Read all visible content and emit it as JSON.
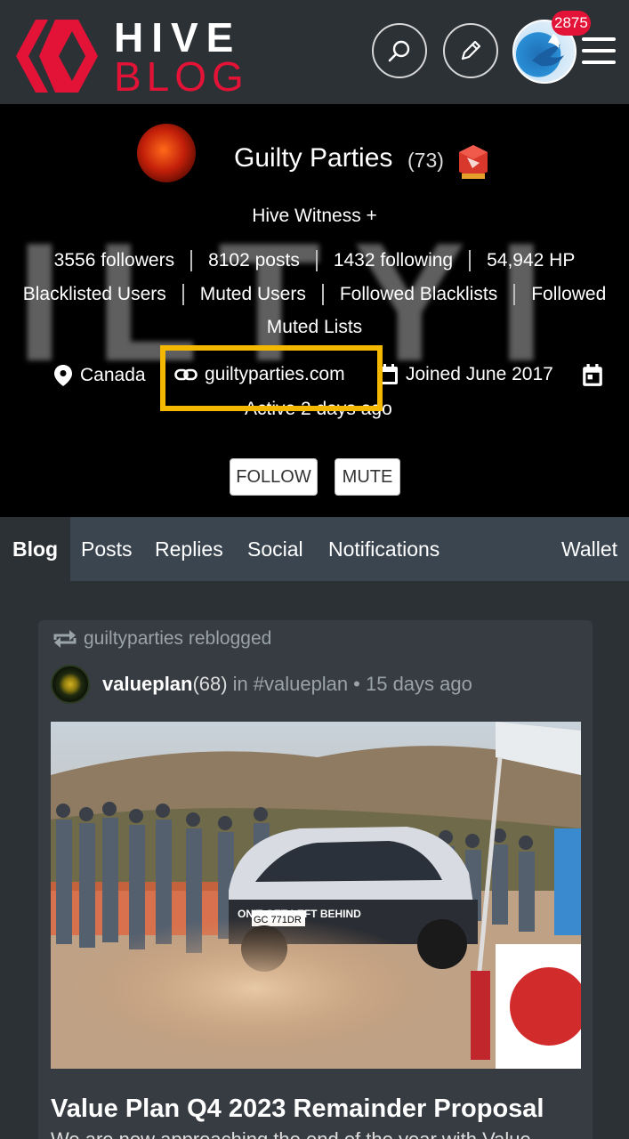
{
  "header": {
    "brand_top": "HIVE",
    "brand_bottom": "BLOG",
    "notification_count": "2875",
    "icons": [
      "hive-logo-icon",
      "search-icon",
      "pencil-icon",
      "menu-icon"
    ]
  },
  "profile": {
    "name": "Guilty Parties",
    "reputation": "(73)",
    "about": "Hive Witness +",
    "followers": "3556 followers",
    "posts": "8102 posts",
    "following": "1432 following",
    "hp": "54,942 HP",
    "lists": [
      "Blacklisted Users",
      "Muted Users",
      "Followed Blacklists",
      "Followed"
    ],
    "muted_lists": "Muted Lists",
    "location": "Canada",
    "website": "guiltyparties.com",
    "joined": "Joined June 2017",
    "active": "Active 2 days ago",
    "follow_label": "FOLLOW",
    "mute_label": "MUTE",
    "background_text": "ILTYI"
  },
  "tabs": [
    "Blog",
    "Posts",
    "Replies",
    "Social",
    "Notifications",
    "Wallet"
  ],
  "post": {
    "reblog_text": "guiltyparties reblogged",
    "author": "valueplan",
    "author_rep": "(68)",
    "community_prefix": "in",
    "community": "#valueplan",
    "age": "• 15 days ago",
    "car_slogan": "ON'T GET LEFT BEHIND",
    "plate": "GC 771DR",
    "title": "Value Plan Q4 2023 Remainder Proposal",
    "snippet": "We are now approaching the end of the year with Value"
  },
  "colors": {
    "accent": "#e31337",
    "highlight": "#f5b800",
    "header_bg": "#2c3136",
    "tabs_bg": "#3b4550"
  }
}
